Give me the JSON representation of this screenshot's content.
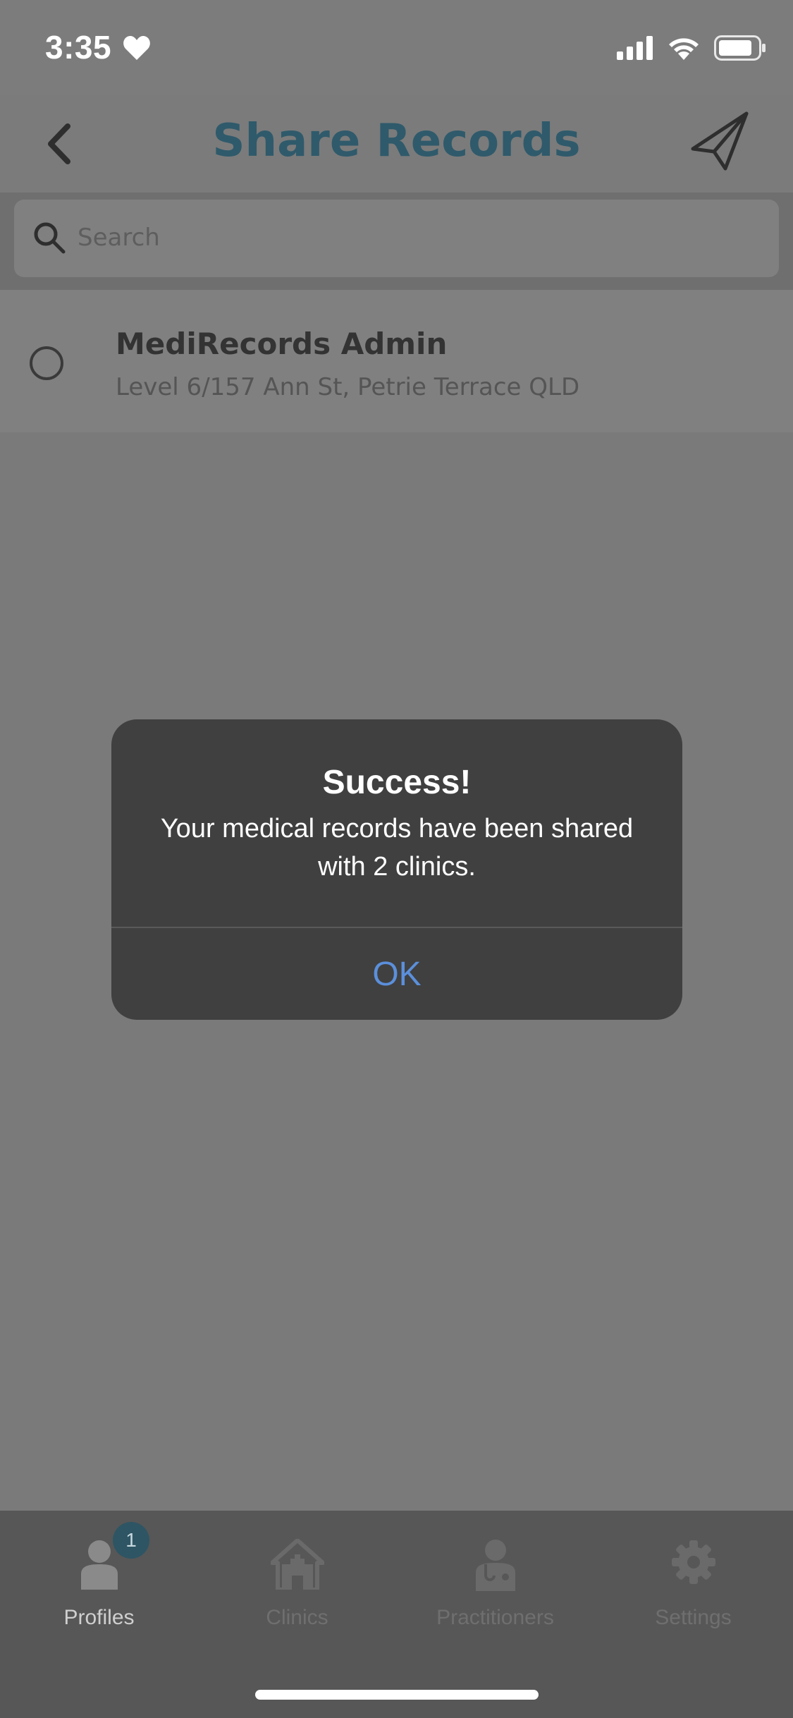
{
  "status_bar": {
    "time": "3:35",
    "icons": [
      "heart-icon",
      "cellular-signal-icon",
      "wifi-icon",
      "battery-icon"
    ]
  },
  "nav": {
    "title": "Share Records",
    "back_icon": "chevron-left-icon",
    "send_icon": "paper-plane-icon"
  },
  "search": {
    "placeholder": "Search",
    "value": ""
  },
  "list": {
    "items": [
      {
        "title": "MediRecords Admin",
        "subtitle": "Level 6/157 Ann St, Petrie Terrace QLD",
        "selected": false
      }
    ]
  },
  "alert": {
    "title": "Success!",
    "message": "Your medical records have been shared with 2 clinics.",
    "ok_label": "OK"
  },
  "tab_bar": {
    "tabs": [
      {
        "label": "Profiles",
        "icon": "person-icon",
        "badge": "1",
        "active": true
      },
      {
        "label": "Clinics",
        "icon": "clinic-icon",
        "active": false
      },
      {
        "label": "Practitioners",
        "icon": "doctor-icon",
        "active": false
      },
      {
        "label": "Settings",
        "icon": "gear-icon",
        "active": false
      }
    ]
  },
  "colors": {
    "accent": "#2f5a6b",
    "alert_button": "#5b8fdb",
    "overlay_background": "#7a7a7a",
    "alert_background": "#404040"
  }
}
